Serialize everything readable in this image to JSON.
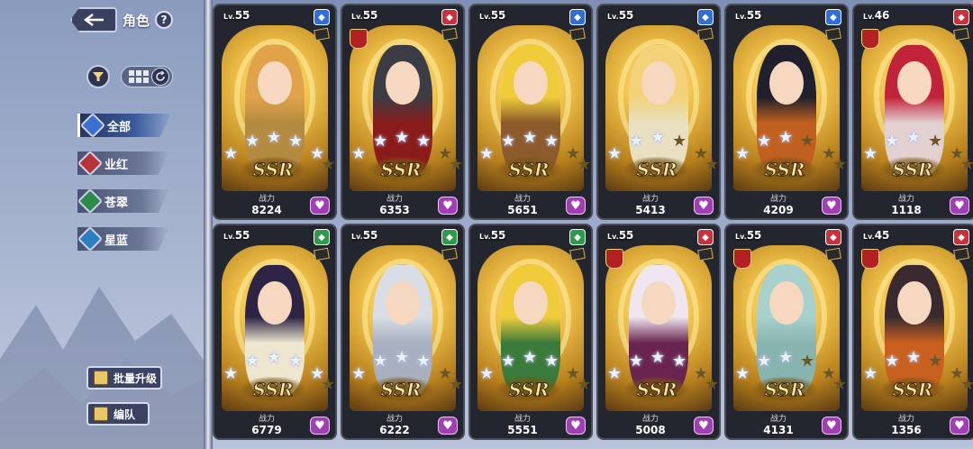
{
  "header": {
    "title": "角色",
    "help": "?"
  },
  "filter": {
    "view_mode": "grid"
  },
  "sidebar": {
    "items": [
      {
        "label": "全部",
        "active": true,
        "color": "#3b6fd1",
        "icon": "grid-icon"
      },
      {
        "label": "业红",
        "active": false,
        "color": "#b8323a",
        "icon": "red-element-icon"
      },
      {
        "label": "苍翠",
        "active": false,
        "color": "#2e8a4a",
        "icon": "green-element-icon"
      },
      {
        "label": "星蓝",
        "active": false,
        "color": "#2b7fbf",
        "icon": "blue-element-icon"
      }
    ]
  },
  "bottom_buttons": {
    "batch_upgrade": "批量升级",
    "team": "编队"
  },
  "power_label": "战力",
  "rarity": "SSR",
  "cards": [
    {
      "lv": "55",
      "power": "8224",
      "element": "blue",
      "stars": 5,
      "hair": "#e0a34a",
      "outfit": "#b38a40"
    },
    {
      "lv": "55",
      "power": "6353",
      "element": "red",
      "stars": 4,
      "hair": "#3c3c44",
      "outfit": "#8a1b1b"
    },
    {
      "lv": "55",
      "power": "5651",
      "element": "blue",
      "stars": 4,
      "hair": "#f0cc3b",
      "outfit": "#8c5a2b"
    },
    {
      "lv": "55",
      "power": "5413",
      "element": "blue",
      "stars": 3,
      "hair": "#f3d27a",
      "outfit": "#e8e0c0"
    },
    {
      "lv": "55",
      "power": "4209",
      "element": "blue",
      "stars": 3,
      "hair": "#1f1f2e",
      "outfit": "#c06020"
    },
    {
      "lv": "46",
      "power": "1118",
      "element": "red",
      "stars": 3,
      "hair": "#c0233a",
      "outfit": "#e3d0d0"
    },
    {
      "lv": "55",
      "power": "6779",
      "element": "green",
      "stars": 5,
      "hair": "#2c2345",
      "outfit": "#efe6cf"
    },
    {
      "lv": "55",
      "power": "6222",
      "element": "green",
      "stars": 4,
      "hair": "#d8dde6",
      "outfit": "#a8b0c0"
    },
    {
      "lv": "55",
      "power": "5551",
      "element": "green",
      "stars": 4,
      "hair": "#f0cc3b",
      "outfit": "#3a7a3a"
    },
    {
      "lv": "55",
      "power": "5008",
      "element": "red",
      "stars": 4,
      "hair": "#efe6ef",
      "outfit": "#6a2450"
    },
    {
      "lv": "55",
      "power": "4131",
      "element": "red",
      "stars": 3,
      "hair": "#a8d0cc",
      "outfit": "#88b4b0"
    },
    {
      "lv": "45",
      "power": "1356",
      "element": "red",
      "stars": 3,
      "hair": "#3a2a30",
      "outfit": "#c86020"
    }
  ],
  "element_colors": {
    "blue": "#2f6fd6",
    "red": "#c8323a",
    "green": "#2e9a4a"
  }
}
